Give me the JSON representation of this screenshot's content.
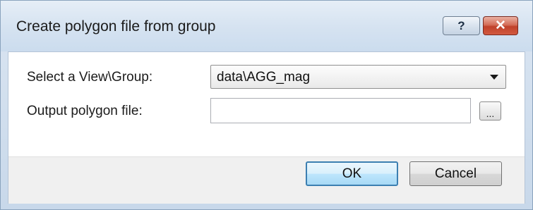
{
  "window": {
    "title": "Create polygon file from group",
    "help_label": "?",
    "close_label": "✕"
  },
  "form": {
    "view_group_label": "Select a View\\Group:",
    "view_group_value": "data\\AGG_mag",
    "output_label": "Output polygon file:",
    "output_value": "",
    "output_placeholder": "",
    "browse_label": "..."
  },
  "buttons": {
    "ok_label": "OK",
    "cancel_label": "Cancel"
  },
  "icons": {
    "help": "help-icon",
    "close": "close-icon",
    "dropdown": "chevron-down-icon"
  },
  "colors": {
    "close_button": "#c0412a",
    "default_button_border": "#3c7fb1"
  }
}
